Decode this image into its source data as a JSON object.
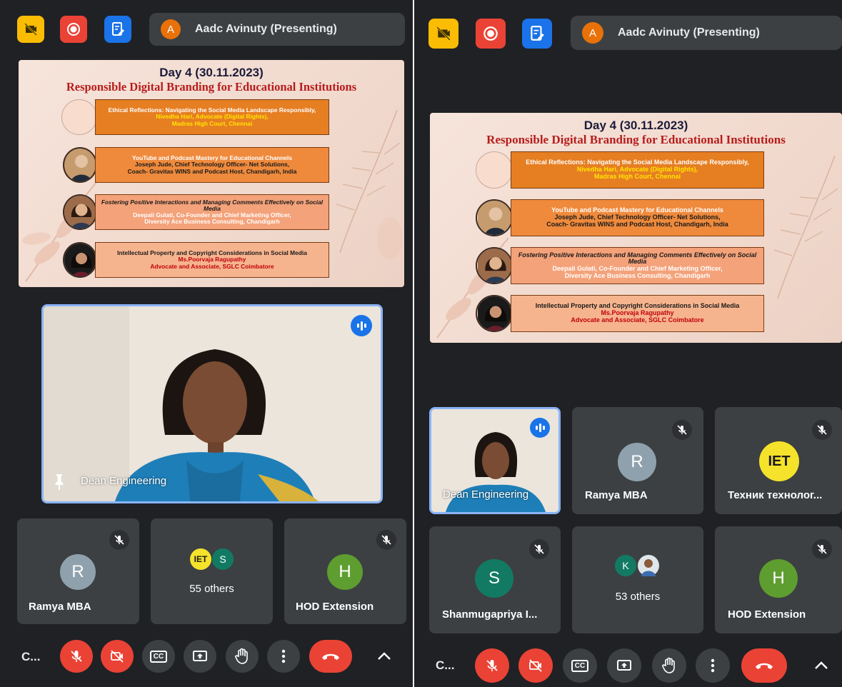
{
  "meeting": {
    "presenter_initial": "A",
    "presenter_label": "Aadc Avinuty (Presenting)"
  },
  "slide": {
    "day": "Day 4 (30.11.2023)",
    "title": "Responsible Digital Branding for Educational Institutions",
    "sessions": [
      {
        "topic": "Ethical Reflections: Navigating the Social Media Landscape Responsibly,",
        "speaker": "Nivedha Hari, Advocate (Digital Rights),",
        "affiliation": "Madras High Court, Chennai"
      },
      {
        "topic": "YouTube and Podcast Mastery for Educational Channels",
        "speaker": "Joseph Jude, Chief Technology Officer- Net Solutions,",
        "affiliation": "Coach- Gravitas WINS and Podcast Host, Chandigarh, India"
      },
      {
        "topic": "Fostering Positive Interactions and Managing Comments Effectively on Social Media",
        "speaker": "Deepali Gulati, Co-Founder and Chief Marketing Officer,",
        "affiliation": "Diversity Ace Business Consulting, Chandigarh"
      },
      {
        "topic": "Intellectual Property and Copyright Considerations in Social Media",
        "speaker": "Ms.Poorvaja Ragupathy",
        "affiliation": "Advocate and Associate, SGLC Coimbatore"
      }
    ]
  },
  "left": {
    "pinned_name": "Dean Engineering",
    "tiles": [
      {
        "name": "Ramya MBA",
        "initial": "R",
        "color": "#8fa1ad"
      },
      {
        "others": "55 others",
        "mini": [
          "IET",
          "S"
        ]
      },
      {
        "name": "HOD Extension",
        "initial": "H",
        "color": "#5e9d2f"
      }
    ]
  },
  "right": {
    "speaker_name": "Dean Engineering",
    "tiles": [
      {
        "name": "Ramya MBA",
        "initial": "R",
        "color": "#8fa1ad"
      },
      {
        "name": "Техник технолог...",
        "initial": "IET",
        "color": "#f5e22b"
      },
      {
        "name": "Shanmugapriya I...",
        "initial": "S",
        "color": "#127a63"
      },
      {
        "others": "53 others",
        "mini": [
          "K"
        ]
      },
      {
        "name": "HOD Extension",
        "initial": "H",
        "color": "#5e9d2f"
      }
    ]
  },
  "controls": {
    "meeting_code": "C...",
    "cc_label": "CC"
  },
  "colors": {
    "background": "#202124",
    "tile": "#3c4043",
    "danger": "#ea4335",
    "accent_blue": "#1a73e8",
    "highlight": "#8ab4f8"
  }
}
